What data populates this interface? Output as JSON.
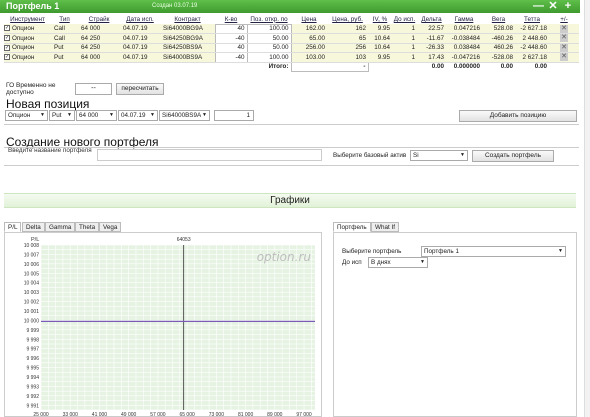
{
  "portfolio": {
    "title": "Портфель 1",
    "created": "Создан 03.07.19",
    "btn_minimize": "—",
    "btn_close": "✕",
    "btn_add": "+",
    "columns": [
      "Инструмент",
      "Тип",
      "Страйк",
      "Дата исп.",
      "Контракт",
      "К-во",
      "Поз. откр. по",
      "Цена",
      "Цена, руб.",
      "IV, %",
      "До исп.",
      "Дельта",
      "Гамма",
      "Вега",
      "Тетта",
      "+/-"
    ],
    "rows": [
      {
        "instrument": "Опцион",
        "type": "Call",
        "strike": "64 000",
        "date": "04.07.19",
        "contract": "Si64000BG9A",
        "qty": "40",
        "open_price": "100.00",
        "price": "162.00",
        "price_rub": "162",
        "iv": "9.95",
        "days": "1",
        "delta": "22.57",
        "gamma": "0.047216",
        "vega": "528.08",
        "theta": "-2 627.18"
      },
      {
        "instrument": "Опцион",
        "type": "Call",
        "strike": "64 250",
        "date": "04.07.19",
        "contract": "Si64250BG9A",
        "qty": "-40",
        "open_price": "50.00",
        "price": "65.00",
        "price_rub": "65",
        "iv": "10.64",
        "days": "1",
        "delta": "-11.67",
        "gamma": "-0.038484",
        "vega": "-460.26",
        "theta": "2 448.60"
      },
      {
        "instrument": "Опцион",
        "type": "Put",
        "strike": "64 250",
        "date": "04.07.19",
        "contract": "Si64250BS9A",
        "qty": "40",
        "open_price": "50.00",
        "price": "256.00",
        "price_rub": "256",
        "iv": "10.64",
        "days": "1",
        "delta": "-26.33",
        "gamma": "0.038484",
        "vega": "460.26",
        "theta": "-2 448.60"
      },
      {
        "instrument": "Опцион",
        "type": "Put",
        "strike": "64 000",
        "date": "04.07.19",
        "contract": "Si64000BS9A",
        "qty": "-40",
        "open_price": "100.00",
        "price": "103.00",
        "price_rub": "103",
        "iv": "9.95",
        "days": "1",
        "delta": "17.43",
        "gamma": "-0.047216",
        "vega": "-528.08",
        "theta": "2 627.18"
      }
    ],
    "total_label": "Итого:",
    "total_price": "-",
    "total_delta": "0.00",
    "total_gamma": "0.000000",
    "total_vega": "0.00",
    "total_theta": "0.00"
  },
  "go": {
    "label": "ГО Временно не доступно",
    "value": "--",
    "recalc_button": "пересчитать"
  },
  "new_position": {
    "title": "Новая позиция",
    "instrument": "Опцион",
    "type": "Put",
    "strike": "64 000",
    "date": "04.07.19",
    "contract": "Si64000BS9A",
    "qty": "1",
    "add_button": "Добавить позицию"
  },
  "create_portfolio": {
    "title": "Создание нового портфеля",
    "name_label": "Введите название портфеля",
    "name_value": "",
    "base_label": "Выберите базовый актив",
    "base_value": "Si",
    "create_button": "Создать портфель"
  },
  "charts": {
    "title": "Графики",
    "tabs": [
      "P/L",
      "Delta",
      "Gamma",
      "Theta",
      "Vega"
    ],
    "active_tab": "P/L",
    "right_tabs": [
      "Портфель",
      "What If"
    ],
    "active_right_tab": "Портфель"
  },
  "right_panel": {
    "portfolio_label": "Выберите портфель",
    "portfolio_value": "Портфель 1",
    "days_label": "До исп",
    "days_value": "В днях"
  },
  "chart_data": {
    "type": "line",
    "title": "",
    "ylabel": "P/L",
    "watermark": "option.ru",
    "marker_label": "64053",
    "marker_x": 64053,
    "xlim": [
      25000,
      100000
    ],
    "ylim": [
      9990.5,
      10008
    ],
    "x_ticks": [
      "25 000",
      "33 000",
      "41 000",
      "49 000",
      "57 000",
      "65 000",
      "73 000",
      "81 000",
      "89 000",
      "97 000"
    ],
    "x_tick_values": [
      25000,
      33000,
      41000,
      49000,
      57000,
      65000,
      73000,
      81000,
      89000,
      97000
    ],
    "y_ticks": [
      "10 008",
      "10 007",
      "10 006",
      "10 005",
      "10 004",
      "10 003",
      "10 002",
      "10 001",
      "10 000",
      "9 999",
      "9 998",
      "9 997",
      "9 996",
      "9 995",
      "9 994",
      "9 993",
      "9 992",
      "9 991"
    ],
    "y_tick_values": [
      10008,
      10007,
      10006,
      10005,
      10004,
      10003,
      10002,
      10001,
      10000,
      9999,
      9998,
      9997,
      9996,
      9995,
      9994,
      9993,
      9992,
      9991
    ],
    "series": [
      {
        "x": [
          25000,
          100000
        ],
        "values": [
          9999.9,
          9999.9
        ]
      }
    ],
    "grid": true,
    "colors": {
      "line": "#7a5cb8",
      "background": "#e6f3e2",
      "grid": "#ffffff",
      "marker": "#333333"
    }
  }
}
